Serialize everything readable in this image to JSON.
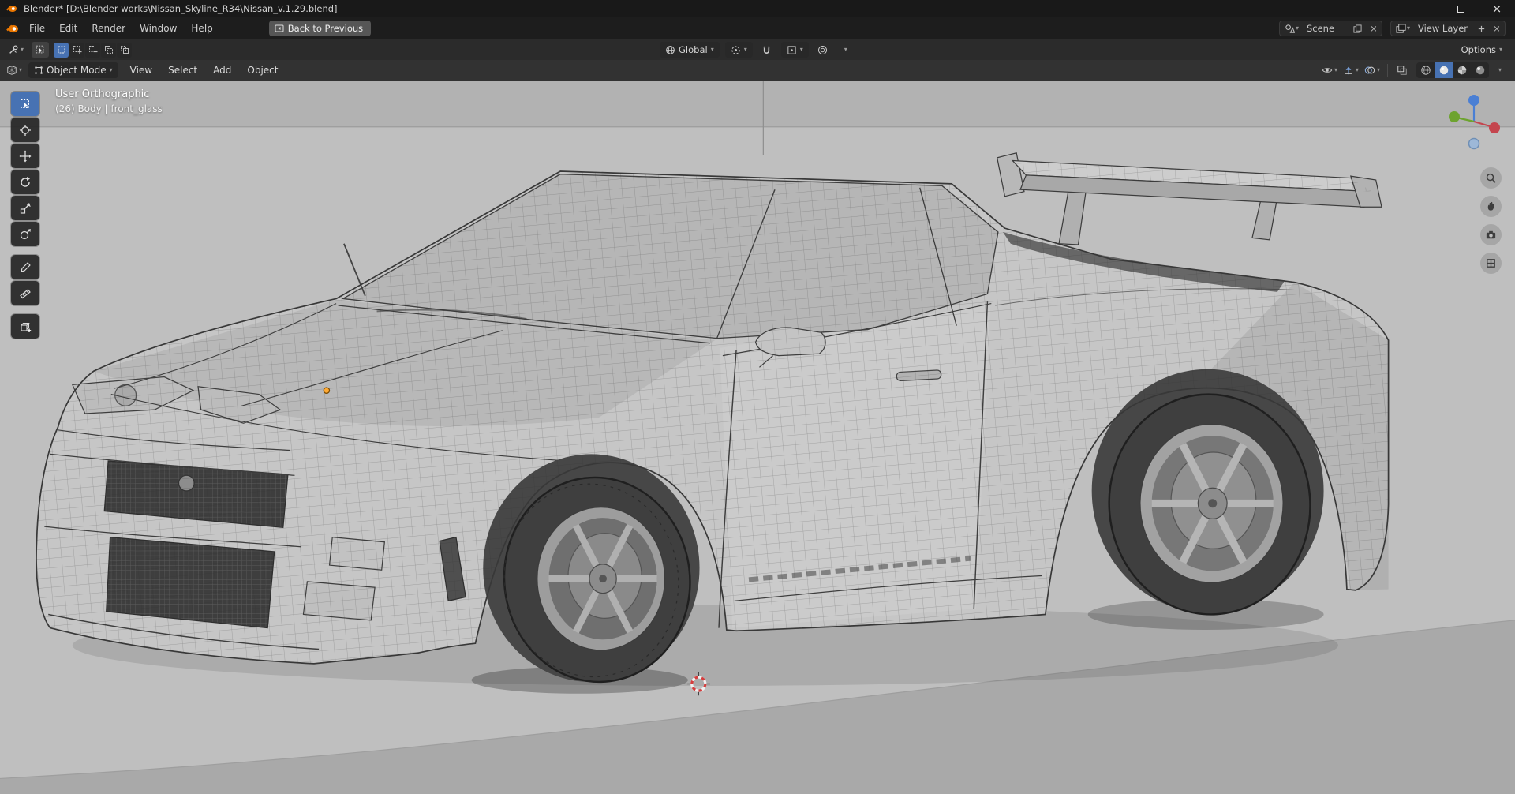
{
  "window": {
    "title": "Blender* [D:\\Blender works\\Nissan_Skyline_R34\\Nissan_v.1.29.blend]"
  },
  "glyphs": {
    "close": "×",
    "chevron": "▾"
  },
  "topbar": {
    "menus": [
      "File",
      "Edit",
      "Render",
      "Window",
      "Help"
    ],
    "back_button": "Back to Previous",
    "scene": {
      "value": "Scene"
    },
    "view_layer": {
      "value": "View Layer"
    }
  },
  "tool_settings": {
    "orientation": {
      "value": "Global"
    },
    "options_label": "Options"
  },
  "viewport_header": {
    "mode": "Object Mode",
    "menus": [
      "View",
      "Select",
      "Add",
      "Object"
    ]
  },
  "viewport": {
    "overlay": {
      "view_label": "User Orthographic",
      "object_label": "(26) Body | front_glass"
    }
  },
  "left_toolbar": {
    "tools": [
      "select-box",
      "cursor",
      "move",
      "rotate",
      "scale",
      "transform",
      "annotate",
      "measure",
      "add-cube"
    ],
    "active_tool": "select-box"
  },
  "colors": {
    "accent": "#4772B3",
    "axis_x": "#C4454E",
    "axis_y": "#6DA32F",
    "axis_z": "#4A7FD4",
    "viewport_bg": "#B0B0B0"
  }
}
